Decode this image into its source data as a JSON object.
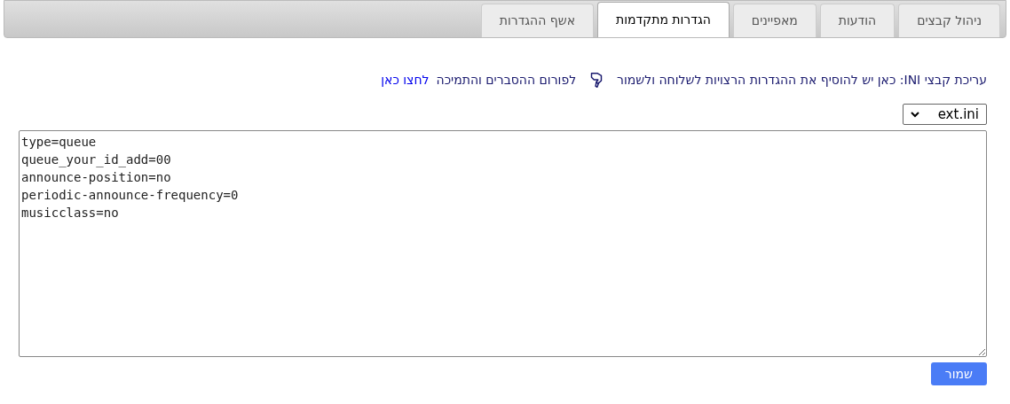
{
  "tabs": [
    {
      "label": "ניהול קבצים",
      "selected": false
    },
    {
      "label": "הודעות",
      "selected": false
    },
    {
      "label": "מאפיינים",
      "selected": false
    },
    {
      "label": "הגדרות מתקדמות",
      "selected": true
    },
    {
      "label": "אשף ההגדרות",
      "selected": false
    }
  ],
  "intro": {
    "text": "עריכת קבצי INI: כאן יש להוסיף את ההגדרות הרצויות לשלוחה ולשמור",
    "forum_text": "לפורום ההסברים והתמיכה",
    "link": "לחצו כאן"
  },
  "file_select": {
    "value": "ext.ini"
  },
  "editor": {
    "value": "type=queue\nqueue_your_id_add=00\nannounce-position=no\nperiodic-announce-frequency=0\nmusicclass=no"
  },
  "save_button": "שמור"
}
